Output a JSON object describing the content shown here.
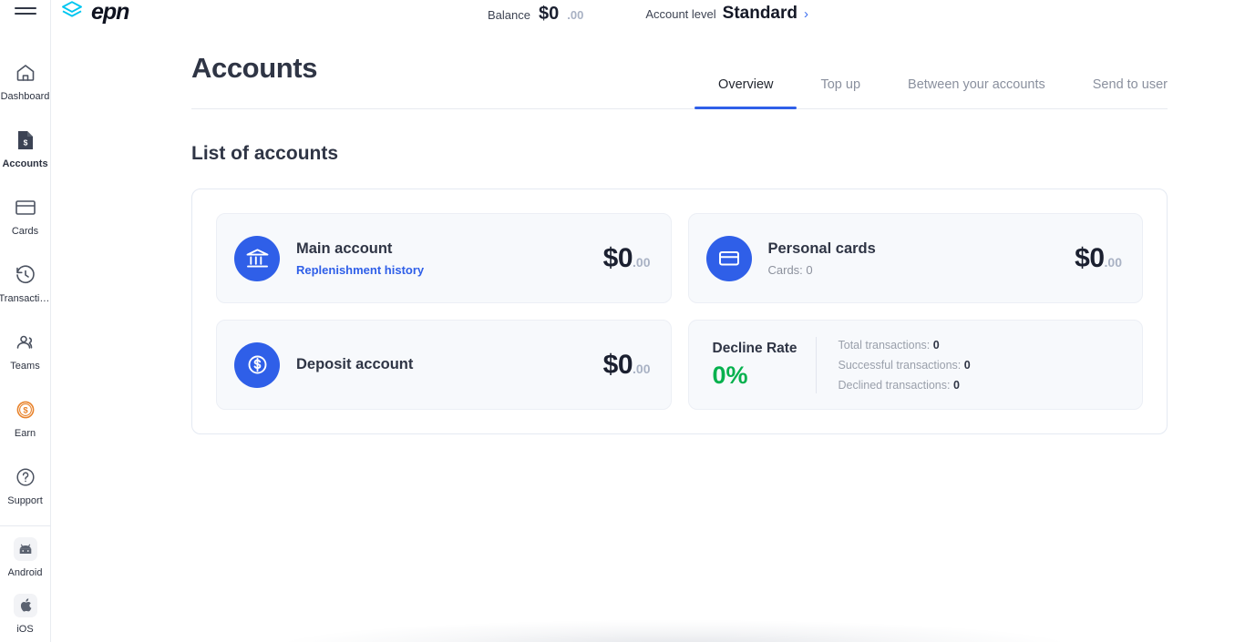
{
  "brand": {
    "logo_text": "epn",
    "logo_mark": "epn-layers-icon",
    "accent": "#00c6f0"
  },
  "topbar": {
    "menu_icon": "hamburger-menu-icon",
    "balance_label": "Balance",
    "balance_amount": "$0",
    "balance_cents": ".00",
    "level_label": "Account level",
    "level_value": "Standard",
    "level_chevron": "›"
  },
  "sidebar": {
    "items": [
      {
        "label": "Dashboard",
        "icon": "home-icon",
        "active": false
      },
      {
        "label": "Accounts",
        "icon": "document-dollar-icon",
        "active": true
      },
      {
        "label": "Cards",
        "icon": "credit-card-icon",
        "active": false
      },
      {
        "label": "Transaction ...",
        "icon": "clock-history-icon",
        "active": false
      },
      {
        "label": "Teams",
        "icon": "users-icon",
        "active": false
      },
      {
        "label": "Earn",
        "icon": "coin-dollar-icon",
        "active": false
      },
      {
        "label": "Support",
        "icon": "question-circle-icon",
        "active": false
      }
    ],
    "apps": [
      {
        "label": "Android",
        "icon": "android-icon"
      },
      {
        "label": "iOS",
        "icon": "apple-icon"
      }
    ]
  },
  "page": {
    "title": "Accounts",
    "tabs": [
      {
        "label": "Overview",
        "active": true
      },
      {
        "label": "Top up",
        "active": false
      },
      {
        "label": "Between your accounts",
        "active": false
      },
      {
        "label": "Send to user",
        "active": false
      }
    ],
    "section_title": "List of accounts"
  },
  "accounts": [
    {
      "name": "Main account",
      "sub": "Replenishment history",
      "sub_is_link": true,
      "icon": "bank-icon",
      "amount": "$0",
      "cents": ".00"
    },
    {
      "name": "Personal cards",
      "sub": "Cards: 0",
      "sub_is_link": false,
      "icon": "credit-card-icon",
      "amount": "$0",
      "cents": ".00"
    },
    {
      "name": "Deposit account",
      "sub": "",
      "sub_is_link": false,
      "icon": "dollar-circle-icon",
      "amount": "$0",
      "cents": ".00"
    }
  ],
  "decline": {
    "title": "Decline Rate",
    "value": "0%",
    "value_color": "#06b14e",
    "stats": [
      {
        "label": "Total transactions:",
        "value": "0"
      },
      {
        "label": "Successful transactions:",
        "value": "0"
      },
      {
        "label": "Declined transactions:",
        "value": "0"
      }
    ]
  },
  "colors": {
    "primary_blue": "#2f5fe8",
    "green": "#06b14e",
    "orange": "#e8822a",
    "card_bg": "#f7f9fc"
  }
}
